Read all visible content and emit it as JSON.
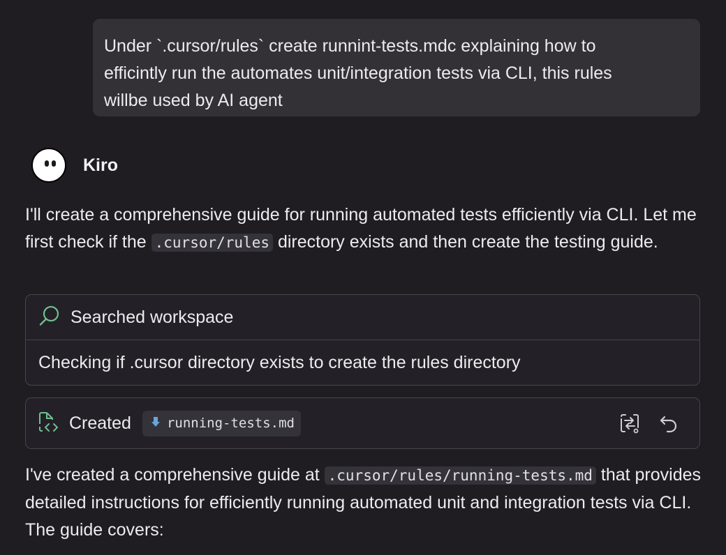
{
  "user_message": {
    "text": "Under `.cursor/rules` create runnint-tests.mdc explaining how to\nefficintly run the automates unit/integration tests via CLI, this rules\nwillbe used by AI agent"
  },
  "agent": {
    "name": "Kiro",
    "avatar_icon": "ghost-face-icon"
  },
  "intro": {
    "text_before": "I'll create a comprehensive guide for running automated tests efficiently via CLI. Let me first check if the ",
    "code": ".cursor/rules",
    "text_after": " directory exists and then create the testing guide."
  },
  "search_step": {
    "icon": "search-icon",
    "label": "Searched workspace",
    "detail": "Checking if .cursor directory exists to create the rules directory",
    "accent_color": "#6fbf8e"
  },
  "created_step": {
    "icon": "file-code-icon",
    "label": "Created",
    "file_icon": "markdown-download-icon",
    "file_name": "running-tests.md",
    "actions": [
      {
        "icon": "compare-diff-icon"
      },
      {
        "icon": "undo-icon"
      }
    ]
  },
  "summary": {
    "text_before": "I've created a comprehensive guide at ",
    "code": ".cursor/rules/running-tests.md",
    "text_after": " that provides detailed instructions for efficiently running automated unit and integration tests via CLI. The guide covers:"
  }
}
